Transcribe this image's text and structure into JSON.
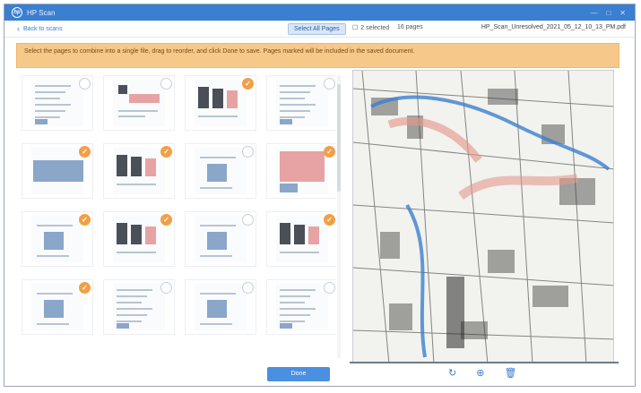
{
  "window": {
    "title": "HP Scan",
    "controls": [
      "—",
      "□",
      "✕"
    ]
  },
  "toolbar": {
    "back_label": "Back to scans",
    "select_all_label": "Select All Pages",
    "selected_count": "2 selected",
    "pages_label": "16 pages",
    "filename": "HP_Scan_Unresolved_2021_05_12_10_13_PM.pdf"
  },
  "banner": {
    "text": "Select the pages to combine into a single file, drag to reorder, and click Done to save. Pages marked will be included in the saved document."
  },
  "thumbnails": [
    {
      "label": "",
      "checked": false
    },
    {
      "label": "",
      "checked": false
    },
    {
      "label": "",
      "checked": true
    },
    {
      "label": "",
      "checked": false
    },
    {
      "label": "",
      "checked": true
    },
    {
      "label": "",
      "checked": true
    },
    {
      "label": "",
      "checked": false
    },
    {
      "label": "",
      "checked": true
    },
    {
      "label": "",
      "checked": true
    },
    {
      "label": "",
      "checked": true
    },
    {
      "label": "",
      "checked": false
    },
    {
      "label": "",
      "checked": true
    },
    {
      "label": "",
      "checked": true
    },
    {
      "label": "",
      "checked": false
    },
    {
      "label": "",
      "checked": false
    },
    {
      "label": "",
      "checked": false
    }
  ],
  "done_label": "Done",
  "preview_tools": [
    "rotate-icon",
    "zoom-icon",
    "delete-icon"
  ]
}
